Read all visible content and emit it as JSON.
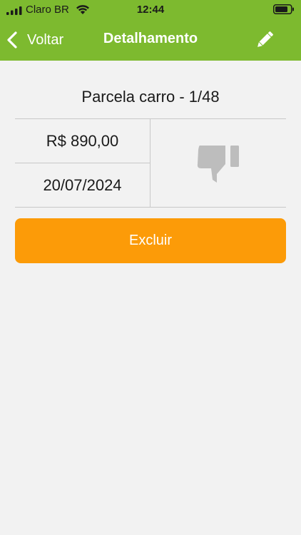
{
  "status_bar": {
    "carrier": "Claro BR",
    "time": "12:44",
    "signal_icon": "cellular-signal-icon",
    "wifi_icon": "wifi-icon",
    "battery_icon": "battery-icon"
  },
  "nav": {
    "back_label": "Voltar",
    "title": "Detalhamento",
    "back_icon": "chevron-left-icon",
    "edit_icon": "pencil-icon"
  },
  "detail": {
    "title": "Parcela carro - 1/48",
    "amount": "R$ 890,00",
    "date": "20/07/2024",
    "status_icon": "thumbs-down-icon"
  },
  "actions": {
    "delete_label": "Excluir"
  },
  "colors": {
    "header": "#7dba2f",
    "delete_button": "#fc9b08",
    "background": "#f2f2f2",
    "status_icon": "#bdbdbd"
  }
}
